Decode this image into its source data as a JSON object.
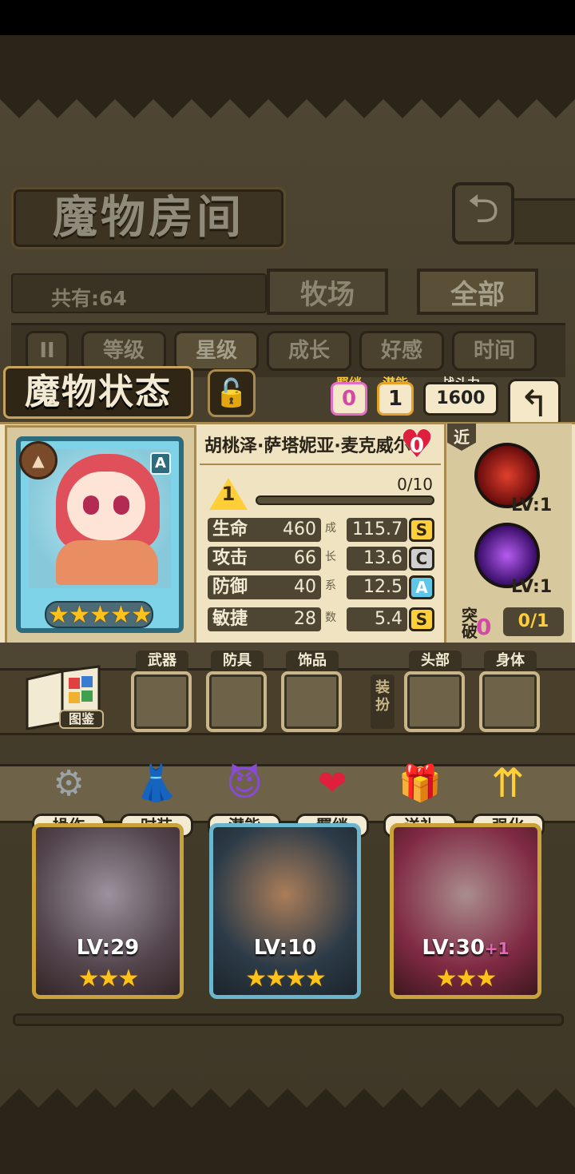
{
  "header": {
    "title": "魔物房间",
    "back_icon": "return-icon"
  },
  "count": {
    "label": "共有:64"
  },
  "tabs": [
    {
      "label": "牧场"
    },
    {
      "label": "全部"
    }
  ],
  "filters": {
    "pause": "II",
    "items": [
      {
        "label": "等级"
      },
      {
        "label": "星级"
      },
      {
        "label": "成长"
      },
      {
        "label": "好感"
      },
      {
        "label": "时间"
      }
    ]
  },
  "status": {
    "title": "魔物状态",
    "bond_label": "羁绊",
    "bond_value": "0",
    "potential_label": "潜能",
    "potential_value": "1",
    "power_label": "战斗力",
    "power_value": "1600"
  },
  "monster": {
    "name": "胡桃泽·萨塔妮亚·麦克威尔",
    "affection": "0",
    "rank": "A",
    "stars": 5,
    "level": "1",
    "exp": "0/10",
    "exp_fraction": 0,
    "stats": [
      {
        "label": "生命",
        "value": "460",
        "growth_char": "成",
        "growth": "115.7",
        "grade": "S"
      },
      {
        "label": "攻击",
        "value": "66",
        "growth_char": "长",
        "growth": "13.6",
        "grade": "C"
      },
      {
        "label": "防御",
        "value": "40",
        "growth_char": "系",
        "growth": "12.5",
        "grade": "A"
      },
      {
        "label": "敏捷",
        "value": "28",
        "growth_char": "数",
        "growth": "5.4",
        "grade": "S"
      }
    ],
    "range": "近",
    "skills": [
      {
        "level": "LV:1"
      },
      {
        "level": "LV:1"
      }
    ],
    "break_label_1": "突",
    "break_label_2": "破",
    "break_count": "0",
    "break_value": "0/1"
  },
  "equipment": {
    "book_label": "图鉴",
    "dress_label": "装扮",
    "slots": [
      {
        "label": "武器"
      },
      {
        "label": "防具"
      },
      {
        "label": "饰品"
      },
      {
        "label": "头部"
      },
      {
        "label": "身体"
      }
    ]
  },
  "actions": [
    {
      "label": "操作",
      "icon": "gear-icon"
    },
    {
      "label": "时装",
      "icon": "outfit-icon"
    },
    {
      "label": "潜能",
      "icon": "demon-icon"
    },
    {
      "label": "羁绊",
      "icon": "hearts-icon"
    },
    {
      "label": "送礼",
      "icon": "gift-icon"
    },
    {
      "label": "强化",
      "icon": "arrows-up-icon"
    }
  ],
  "roster": [
    {
      "level": "LV:29",
      "plus": "",
      "stars": "★★★"
    },
    {
      "level": "LV:10",
      "plus": "",
      "stars": "★★★★"
    },
    {
      "level": "LV:30",
      "plus": "+1",
      "stars": "★★★"
    }
  ]
}
